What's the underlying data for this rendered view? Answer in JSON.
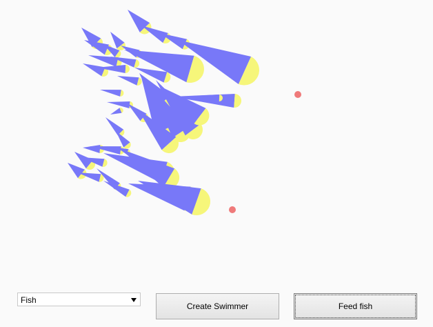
{
  "colors": {
    "fish_body": "#7878f8",
    "fish_head": "#f6f67a",
    "food": "#ef7a7a",
    "background": "#fafafa"
  },
  "controls": {
    "swimmer_select": {
      "selected": "Fish"
    },
    "create_button_label": "Create Swimmer",
    "feed_button_label": "Feed fish"
  },
  "aquarium": {
    "food_pellet_count": 2
  }
}
